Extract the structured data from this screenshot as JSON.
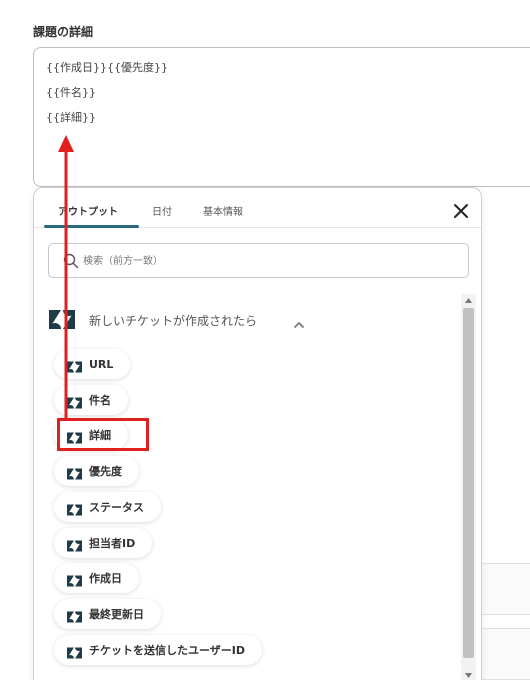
{
  "field": {
    "label": "課題の詳細",
    "lines": [
      "{{作成日}}{{優先度}}",
      "{{件名}}",
      "{{詳細}}"
    ]
  },
  "panel": {
    "tabs": [
      {
        "label": "アウトプット",
        "active": true
      },
      {
        "label": "日付",
        "active": false
      },
      {
        "label": "基本情報",
        "active": false
      }
    ],
    "search_placeholder": "検索（前方一致）",
    "section_title": "新しいチケットが作成されたら",
    "items": [
      "URL",
      "件名",
      "詳細",
      "優先度",
      "ステータス",
      "担当者ID",
      "作成日",
      "最終更新日",
      "チケットを送信したユーザーID"
    ],
    "highlighted_item": "詳細"
  },
  "icons": {
    "app_logo": "zendesk-logo-icon",
    "close": "close-icon",
    "search": "search-icon",
    "collapse": "chevron-up-icon"
  },
  "colors": {
    "tab_accent": "#2a6a78",
    "highlight": "#e0201e"
  }
}
